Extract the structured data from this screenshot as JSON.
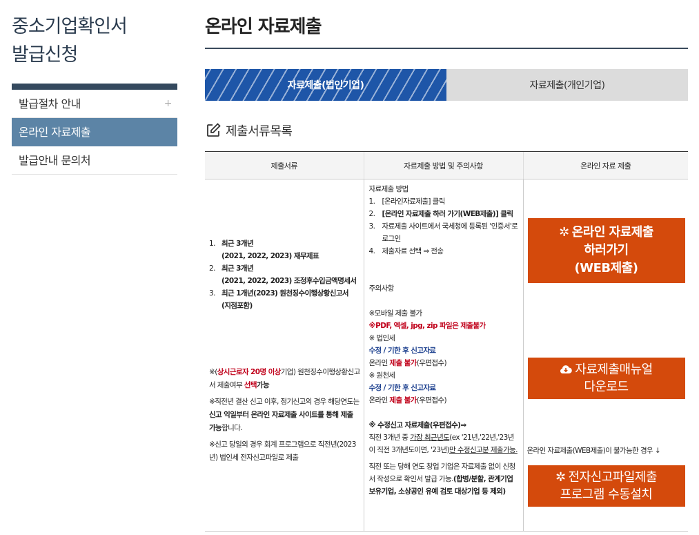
{
  "sidebar": {
    "title_line1": "중소기업확인서",
    "title_line2": "발급신청",
    "items": [
      {
        "label": "발급절차 안내",
        "plus": "+"
      },
      {
        "label": "온라인 자료제출"
      },
      {
        "label": "발급안내 문의처"
      }
    ]
  },
  "main": {
    "title": "온라인 자료제출",
    "tabs": [
      {
        "label": "자료제출(법인기업)"
      },
      {
        "label": "자료제출(개인기업)"
      }
    ],
    "section_title": "제출서류목록",
    "table": {
      "headers": [
        "제출서류",
        "자료제출 방법 및 주의사항",
        "온라인 자료 제출"
      ],
      "docs": [
        {
          "n": "1.",
          "line1": "최근 3개년",
          "line2": "(2021, 2022, 2023) 재무제표"
        },
        {
          "n": "2.",
          "line1": "최근 3개년",
          "line2": "(2021, 2022, 2023) 조정후수입금액명세서"
        },
        {
          "n": "3.",
          "line1": "최근 1개년(2023) 원천징수이행상황신고서",
          "line2": "(지점포함)"
        }
      ],
      "notes": {
        "n1_pre": "※(",
        "n1_red": "상시근로자 20명 이상",
        "n1_mid": "기업) 원천징수이행상황신고서 제출여부 ",
        "n1_red2": "선택",
        "n1_post": "가능",
        "n2_pre": "※직전년 결산 신고 이후, 정기신고의 경우 해당연도는 ",
        "n2_bold": "신고 익일부터 온라인 자료제출 사이트를 통해 제출 가능",
        "n2_post": "합니다.",
        "n3": "※신고 당일의 경우 회계 프로그램으로 직전년(2023년) 법인세 전자신고파일로 제출"
      },
      "method": {
        "heading": "자료제출 방법",
        "steps": [
          {
            "n": "1.",
            "text": "[온라인자료제출] 클릭"
          },
          {
            "n": "2.",
            "text": "[온라인 자료제출 하러 가기(WEB제출)] 클릭"
          },
          {
            "n": "3.",
            "text": "자료제출 사이트에서 국세청에 등록된 '인증서'로 로그인"
          },
          {
            "n": "4.",
            "text": "제출자료 선택 ⇒ 전송"
          }
        ],
        "caution_heading": "주의사항",
        "mobile": "※모바일 제출 불가",
        "formats_red": "※PDF, 엑셀, jpg, zip 파일은 제출불가",
        "corp_tax": "※ 법인세",
        "corp_revised": "수정 / 기한 후 신고자료",
        "corp_online_pre": "온라인 ",
        "corp_online_red": "제출 불가",
        "corp_online_post": "(우편접수)",
        "withhold": "※ 원천세",
        "withhold_revised": "수정 / 기한 후 신고자료",
        "withhold_online_pre": "온라인 ",
        "withhold_online_red": "제출 불가",
        "withhold_online_post": "(우편접수)",
        "revised_heading": "※ 수정신고 자료제출(우편접수)⇒",
        "revised_p_pre": "직전 3개년 중 ",
        "revised_p_u": "가장 최근년도",
        "revised_p_mid": "(ex '21년,'22년,'23년이 직전 3개년도이면, '23년)",
        "revised_p_bold": "만 수정신고분 제출가",
        "revised_p_post": "능.",
        "startup_pre": "직전 또는 당해 연도 창업 기업은 자료제출 없이 신청서 작성으로 확인서 발급 가능.",
        "startup_bold": "(합병/분할, 관계기업 보유기업, 소상공인 유예 검토 대상기업 등 제외)"
      },
      "online": {
        "web_btn_line1": "온라인 자료제출",
        "web_btn_line2": "하러가기",
        "web_btn_line3": "(WEB제출)",
        "manual_btn_line1": "자료제출매뉴얼",
        "manual_btn_line2": "다운로드",
        "web_unavailable": "온라인 자료제출(WEB제출)이 불가능한 경우 ↓",
        "program_btn_line1": "전자신고파일제출",
        "program_btn_line2": "프로그램 수동설치"
      }
    }
  },
  "colors": {
    "tab_active": "#1e56a8",
    "sidebar_active": "#5c84a6",
    "button_orange": "#d44a0c",
    "warning_red": "#c0001a",
    "link_blue": "#1b3f8e"
  },
  "icons": [
    "plus-icon",
    "edit-icon",
    "gear-icon",
    "cloud-download-icon"
  ]
}
